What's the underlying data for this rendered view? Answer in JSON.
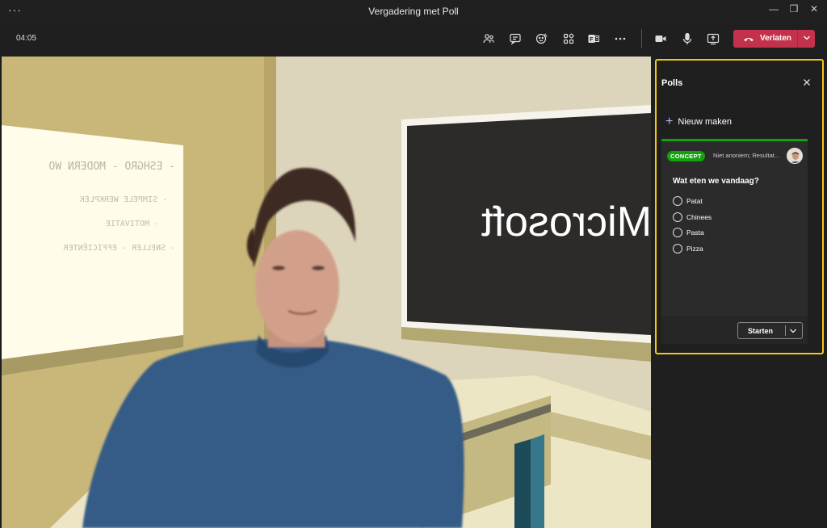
{
  "window": {
    "title": "Vergadering met Poll",
    "more_glyph": "···",
    "minimize_glyph": "—",
    "restore_glyph": "❐",
    "close_glyph": "✕"
  },
  "toolbar": {
    "timer": "04:05",
    "icons": [
      "people-icon",
      "chat-icon",
      "reactions-icon",
      "apps-icon",
      "polls-icon",
      "more-actions-icon",
      "camera-icon",
      "mic-icon",
      "share-screen-icon"
    ],
    "leave_label": "Verlaten"
  },
  "stage": {
    "screen_text": "Microsoft",
    "whiteboard_lines": [
      "- ESHGRO - MODERN WO",
      "- SIMPELE WERKPLEK",
      "- MOTIVATIE",
      "- SNELLER - EFFICIËNTER"
    ]
  },
  "polls_panel": {
    "title": "Polls",
    "new_label": "Nieuw maken",
    "poll": {
      "status": "CONCEPT",
      "meta": "Niet anoniem; Resultat...",
      "question": "Wat eten we vandaag?",
      "options": [
        "Patat",
        "Chinees",
        "Pasta",
        "Pizza"
      ],
      "start_label": "Starten"
    }
  },
  "colors": {
    "accent": "#7f85f5",
    "leave": "#c4314b",
    "concept_badge": "#13a10e",
    "highlight_frame": "#f2c811"
  }
}
